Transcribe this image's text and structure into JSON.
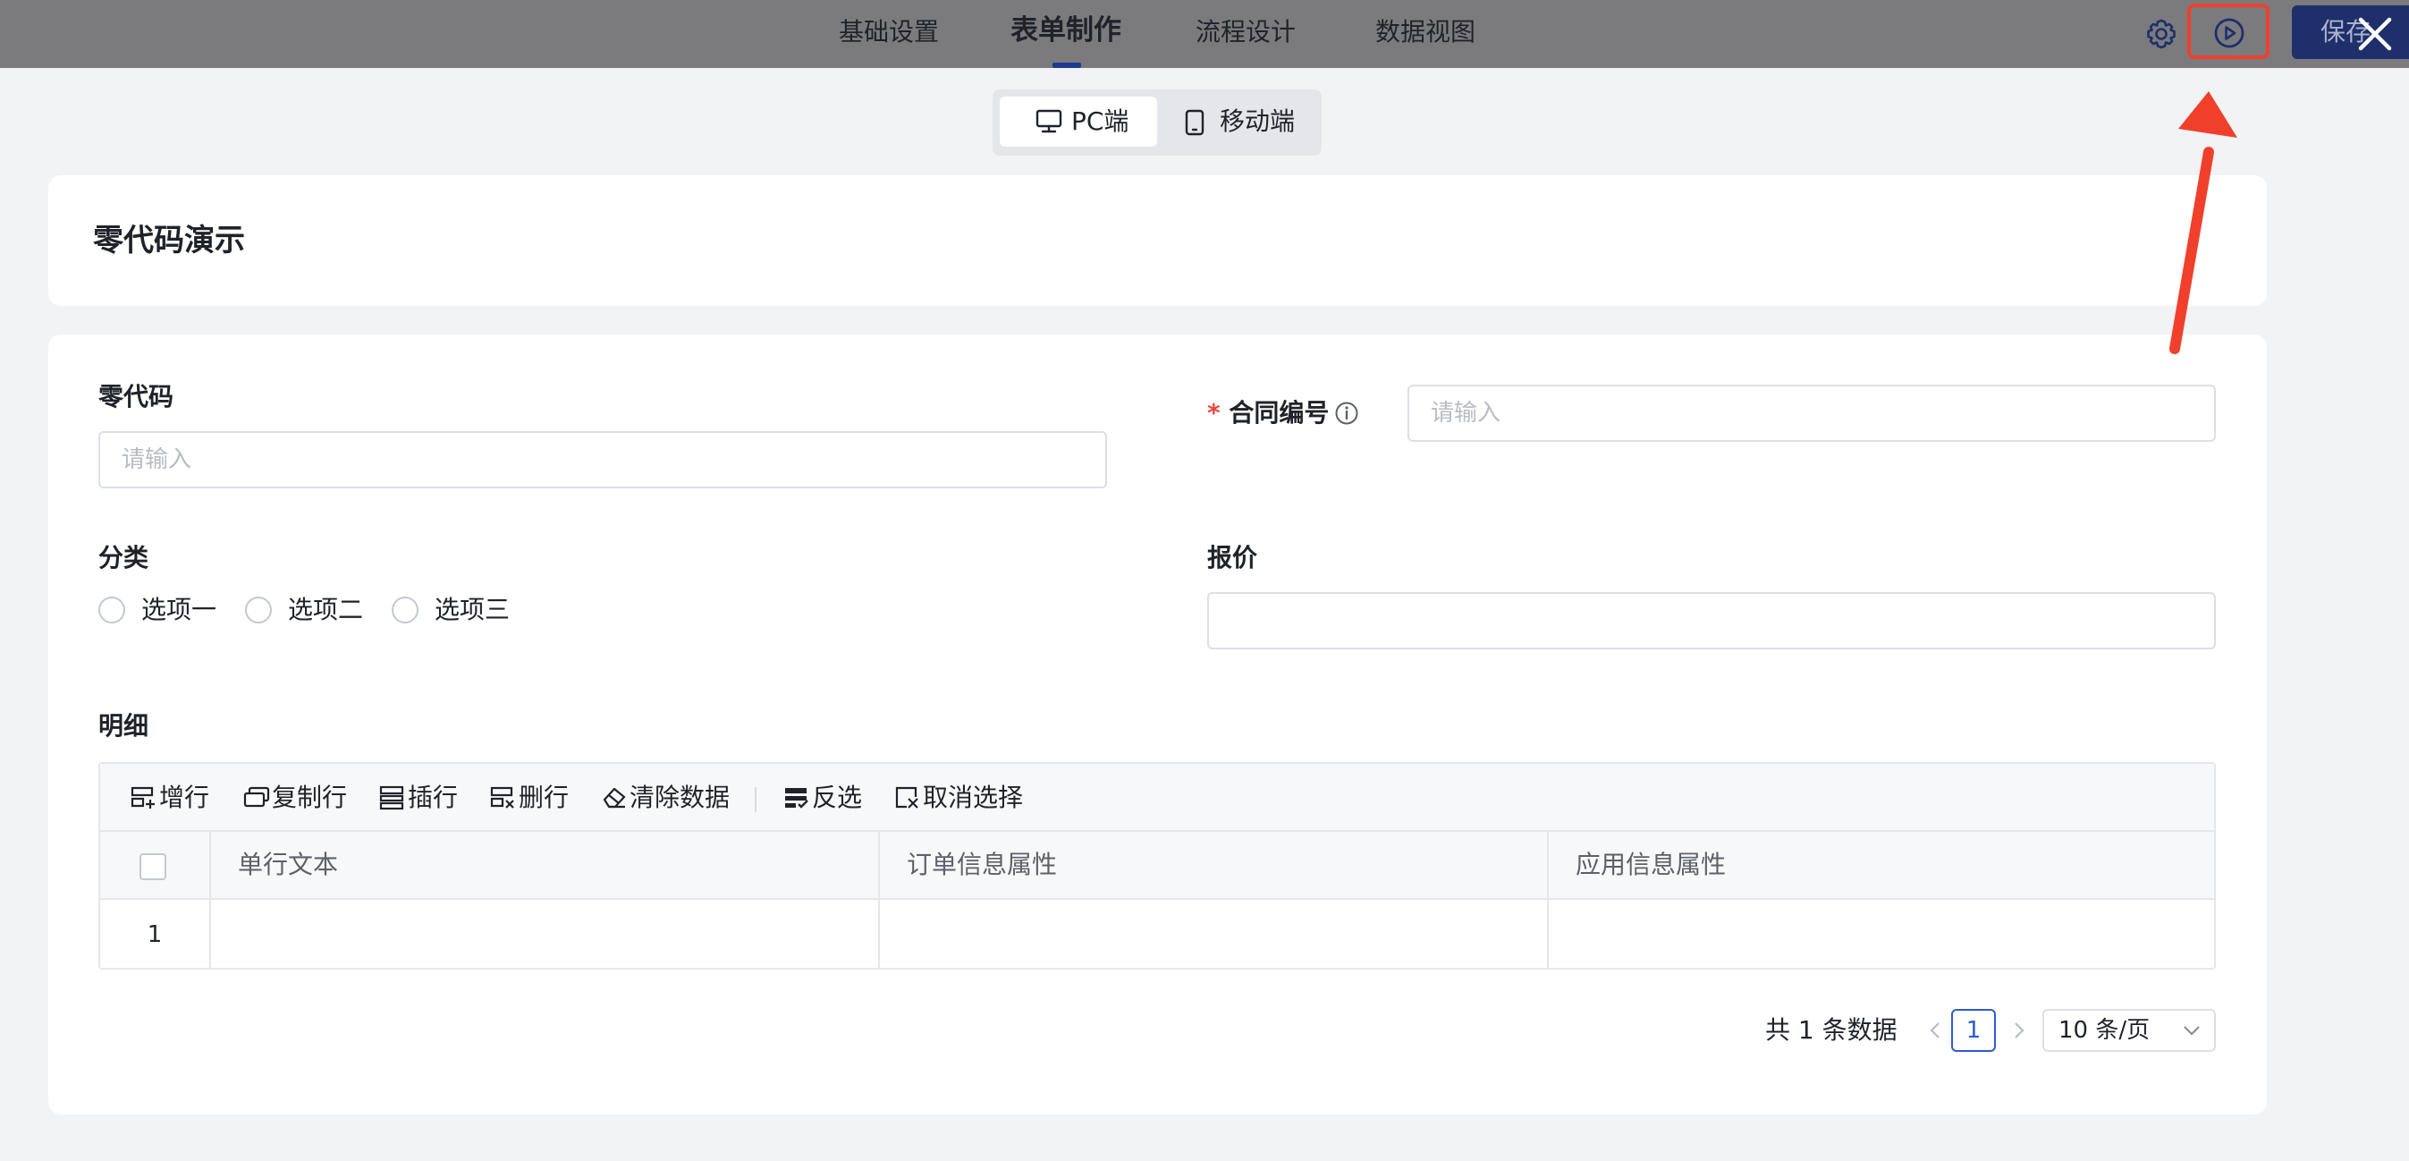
{
  "header": {
    "tabs": [
      {
        "label": "基础设置",
        "active": false
      },
      {
        "label": "表单制作",
        "active": true
      },
      {
        "label": "流程设计",
        "active": false
      },
      {
        "label": "数据视图",
        "active": false
      }
    ],
    "settings_icon": "gear-icon",
    "preview_icon": "play-circle-icon",
    "save_label": "保存",
    "close_icon": "close-icon"
  },
  "device_switch": {
    "pc_label": "PC端",
    "mobile_label": "移动端",
    "selected": "PC端"
  },
  "form": {
    "title": "零代码演示",
    "fields": {
      "lingdaima": {
        "label": "零代码",
        "placeholder": "请输入"
      },
      "contract_no": {
        "required_mark": "*",
        "label": "合同编号",
        "placeholder": "请输入"
      },
      "category": {
        "label": "分类",
        "options": [
          "选项一",
          "选项二",
          "选项三"
        ]
      },
      "quote": {
        "label": "报价",
        "value": ""
      }
    },
    "detail": {
      "label": "明细",
      "toolbar": [
        "增行",
        "复制行",
        "插行",
        "删行",
        "清除数据",
        "反选",
        "取消选择"
      ],
      "columns": [
        "单行文本",
        "订单信息属性",
        "应用信息属性"
      ],
      "rows": [
        {
          "index": "1",
          "cells": [
            "",
            "",
            ""
          ]
        }
      ]
    },
    "pagination": {
      "total_text": "共 1 条数据",
      "current_page": "1",
      "page_size": "10 条/页"
    }
  },
  "colors": {
    "topbar_bg": "#7b7b7d",
    "save_bg": "#1e2f6b",
    "annotation_red": "#f0402c",
    "primary": "#2d5bd1"
  }
}
